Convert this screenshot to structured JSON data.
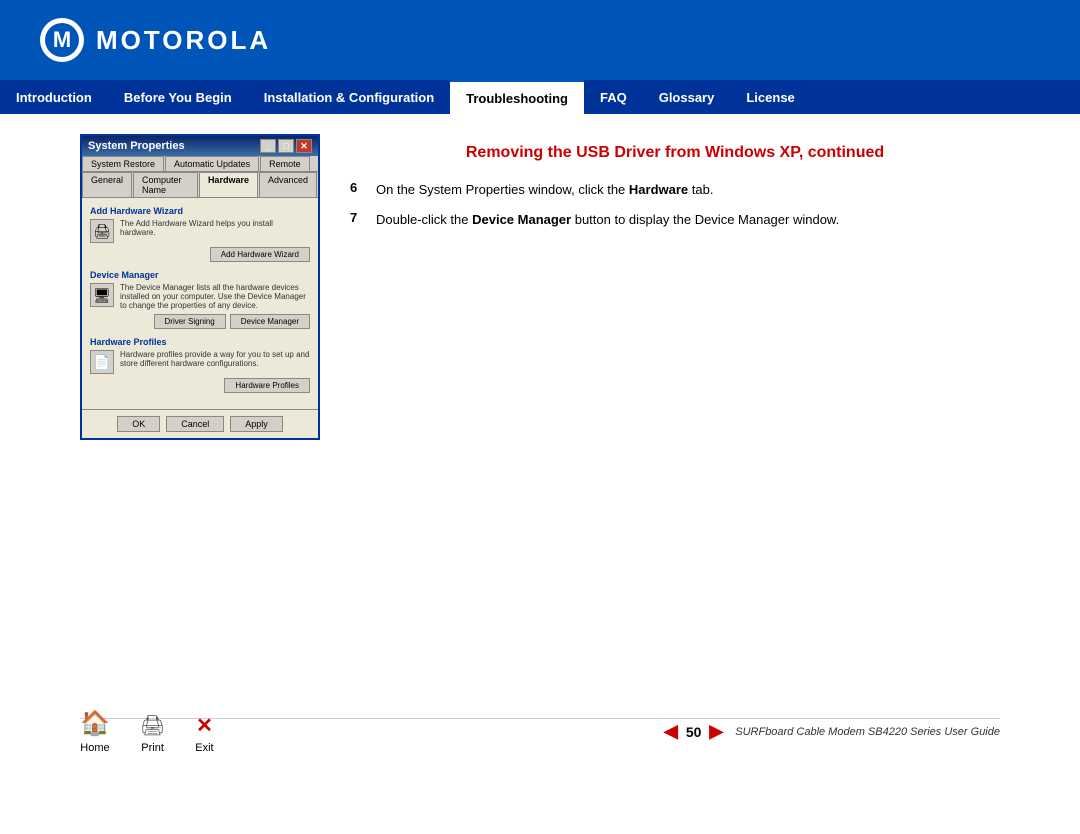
{
  "header": {
    "logo_text": "MOTOROLA",
    "background_color": "#0055b8"
  },
  "navbar": {
    "items": [
      {
        "label": "Introduction",
        "active": false
      },
      {
        "label": "Before You Begin",
        "active": false
      },
      {
        "label": "Installation & Configuration",
        "active": false
      },
      {
        "label": "Troubleshooting",
        "active": true
      },
      {
        "label": "FAQ",
        "active": false
      },
      {
        "label": "Glossary",
        "active": false
      },
      {
        "label": "License",
        "active": false
      }
    ]
  },
  "main": {
    "page_title": "Removing the USB Driver from Windows XP, continued",
    "steps": [
      {
        "number": "6",
        "text_before": "On the System Properties window, click the ",
        "bold": "Hardware",
        "text_after": " tab."
      },
      {
        "number": "7",
        "text_before": "Double-click the ",
        "bold": "Device Manager",
        "text_after": " button to display the Device Manager window."
      }
    ]
  },
  "dialog": {
    "title": "System Properties",
    "tabs_row1": [
      "System Restore",
      "Automatic Updates",
      "Remote"
    ],
    "tabs_row2": [
      "General",
      "Computer Name",
      "Hardware",
      "Advanced"
    ],
    "active_tab": "Hardware",
    "sections": [
      {
        "title": "Add Hardware Wizard",
        "text": "The Add Hardware Wizard helps you install hardware.",
        "button": "Add Hardware Wizard"
      },
      {
        "title": "Device Manager",
        "text": "The Device Manager lists all the hardware devices installed on your computer. Use the Device Manager to change the properties of any device.",
        "buttons": [
          "Driver Signing",
          "Device Manager"
        ]
      },
      {
        "title": "Hardware Profiles",
        "text": "Hardware profiles provide a way for you to set up and store different hardware configurations.",
        "button": "Hardware Profiles"
      }
    ],
    "bottom_buttons": [
      "OK",
      "Cancel",
      "Apply"
    ]
  },
  "footer": {
    "home_label": "Home",
    "print_label": "Print",
    "exit_label": "Exit",
    "page_number": "50",
    "guide_text": "SURFboard Cable Modem SB4220 Series User Guide"
  }
}
